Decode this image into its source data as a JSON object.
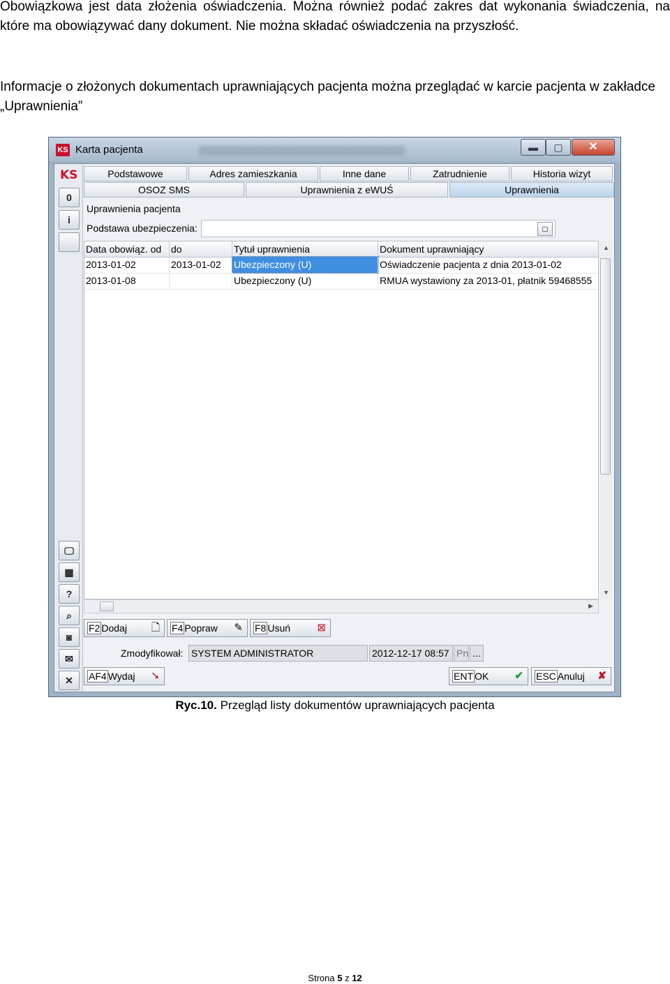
{
  "doc": {
    "para1": "Obowiązkowa jest data złożenia oświadczenia. Można również podać zakres dat wykonania świadczenia, na które ma obowiązywać dany dokument. Nie można składać oświadczenia na przyszłość.",
    "para2": "Informacje o złożonych dokumentach uprawniających pacjenta można przeglądać w karcie pacjenta w zakładce „Uprawnienia”",
    "caption_label": "Ryc.10.",
    "caption_text": " Przegląd listy dokumentów uprawniających pacjenta",
    "footer_prefix": "Strona ",
    "footer_page": "5",
    "footer_mid": " z ",
    "footer_total": "12"
  },
  "window": {
    "title": "Karta pacjenta",
    "logo": "KS",
    "min": "▬",
    "max": "▢",
    "close": "✕"
  },
  "tabs_row1": [
    "Podstawowe",
    "Adres zamieszkania",
    "Inne dane",
    "Zatrudnienie",
    "Historia wizyt"
  ],
  "tabs_row2": [
    "OSOZ SMS",
    "Uprawnienia z eWUŚ",
    "Uprawnienia"
  ],
  "active_tab": "Uprawnienia",
  "section_title": "Uprawnienia pacjenta",
  "field_label": "Podstawa ubezpieczenia:",
  "field_value": "",
  "grid": {
    "headers": [
      "Data obowiąz. od",
      "do",
      "Tytuł uprawnienia",
      "Dokument uprawniający"
    ],
    "rows": [
      [
        "2013-01-02",
        "2013-01-02",
        "Ubezpieczony (U)",
        "Oświadczenie pacjenta z dnia 2013-01-02"
      ],
      [
        "2013-01-08",
        "",
        "Ubezpieczony (U)",
        "RMUA wystawiony za 2013-01, płatnik 59468555"
      ]
    ]
  },
  "left_toolbar": {
    "btn0": "0",
    "btn_info": "i",
    "btn_help": "?",
    "btn_close": "✕"
  },
  "buttons": {
    "add_key": "F2",
    "add_label": "Dodaj",
    "edit_key": "F4",
    "edit_label": "Popraw",
    "del_key": "F8",
    "del_label": "Usuń",
    "issue_key": "AF4",
    "issue_label": "Wydaj",
    "ok_key": "ENT",
    "ok_label": "OK",
    "cancel_key": "ESC",
    "cancel_label": "Anuluj"
  },
  "modified": {
    "label": "Zmodyfikował:",
    "user": "SYSTEM ADMINISTRATOR",
    "datetime": "2012-12-17 08:57",
    "day": "Pn",
    "more": "..."
  }
}
